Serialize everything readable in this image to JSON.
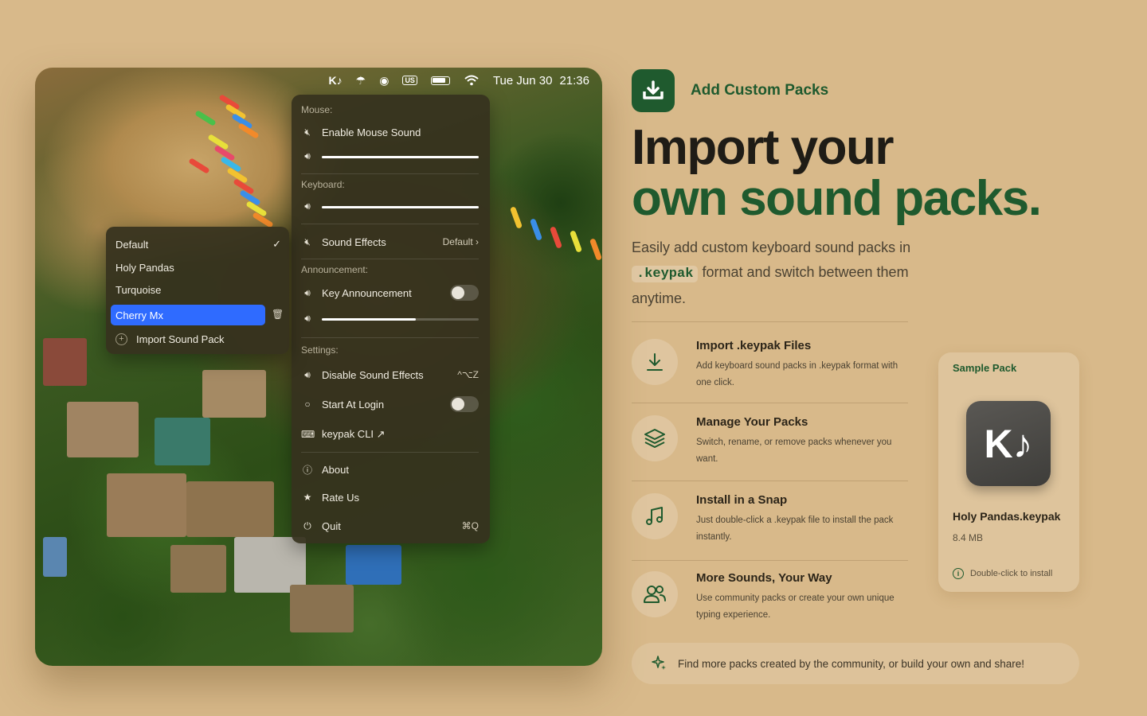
{
  "menubar": {
    "logo": "K♪",
    "date": "Tue Jun 30",
    "time": "21:36",
    "keyboard_layout": "US"
  },
  "menu": {
    "mouse_header": "Mouse:",
    "enable_mouse_sound": "Enable Mouse Sound",
    "mouse_volume": 1.0,
    "keyboard_header": "Keyboard:",
    "keyboard_volume": 1.0,
    "sound_effects_label": "Sound Effects",
    "sound_effects_value": "Default",
    "announcement_header": "Announcement:",
    "key_announcement": "Key Announcement",
    "key_announcement_on": false,
    "announcement_volume": 0.6,
    "settings_header": "Settings:",
    "disable_sound_effects": "Disable Sound Effects",
    "disable_shortcut": "^⌥Z",
    "start_at_login": "Start At Login",
    "start_at_login_on": false,
    "keypak_cli": "keypak CLI ↗",
    "about": "About",
    "rate_us": "Rate Us",
    "quit": "Quit",
    "quit_shortcut": "⌘Q"
  },
  "submenu": {
    "items": [
      "Default",
      "Holy Pandas",
      "Turquoise",
      "Cherry Mx"
    ],
    "checked": "Default",
    "selected": "Cherry Mx",
    "import": "Import Sound Pack"
  },
  "hero": {
    "eyebrow": "Add Custom Packs",
    "title_line1": "Import your",
    "title_line2": "own sound packs.",
    "lead_before": "Easily add custom keyboard sound packs in",
    "lead_code": ".keypak",
    "lead_after": "format and switch between them anytime."
  },
  "features": [
    {
      "icon": "download-icon",
      "title": "Import .keypak Files",
      "desc": "Add keyboard sound packs in .keypak format with one click."
    },
    {
      "icon": "layers-icon",
      "title": "Manage Your Packs",
      "desc": "Switch, rename, or remove packs whenever you want."
    },
    {
      "icon": "music-note-icon",
      "title": "Install in a Snap",
      "desc": "Just double-click a .keypak file to install the pack instantly."
    },
    {
      "icon": "users-icon",
      "title": "More Sounds, Your Way",
      "desc": "Use community packs or create your own unique typing experience."
    }
  ],
  "sample": {
    "label": "Sample Pack",
    "icon_text": "K♪",
    "name": "Holy Pandas.keypak",
    "size": "8.4 MB",
    "hint": "Double-click to install"
  },
  "footer": {
    "text": "Find more packs created by the community, or build your own and share!"
  },
  "colors": {
    "background": "#d8b98a",
    "accent_green": "#1f5a2e",
    "selection_blue": "#2f6bff"
  }
}
